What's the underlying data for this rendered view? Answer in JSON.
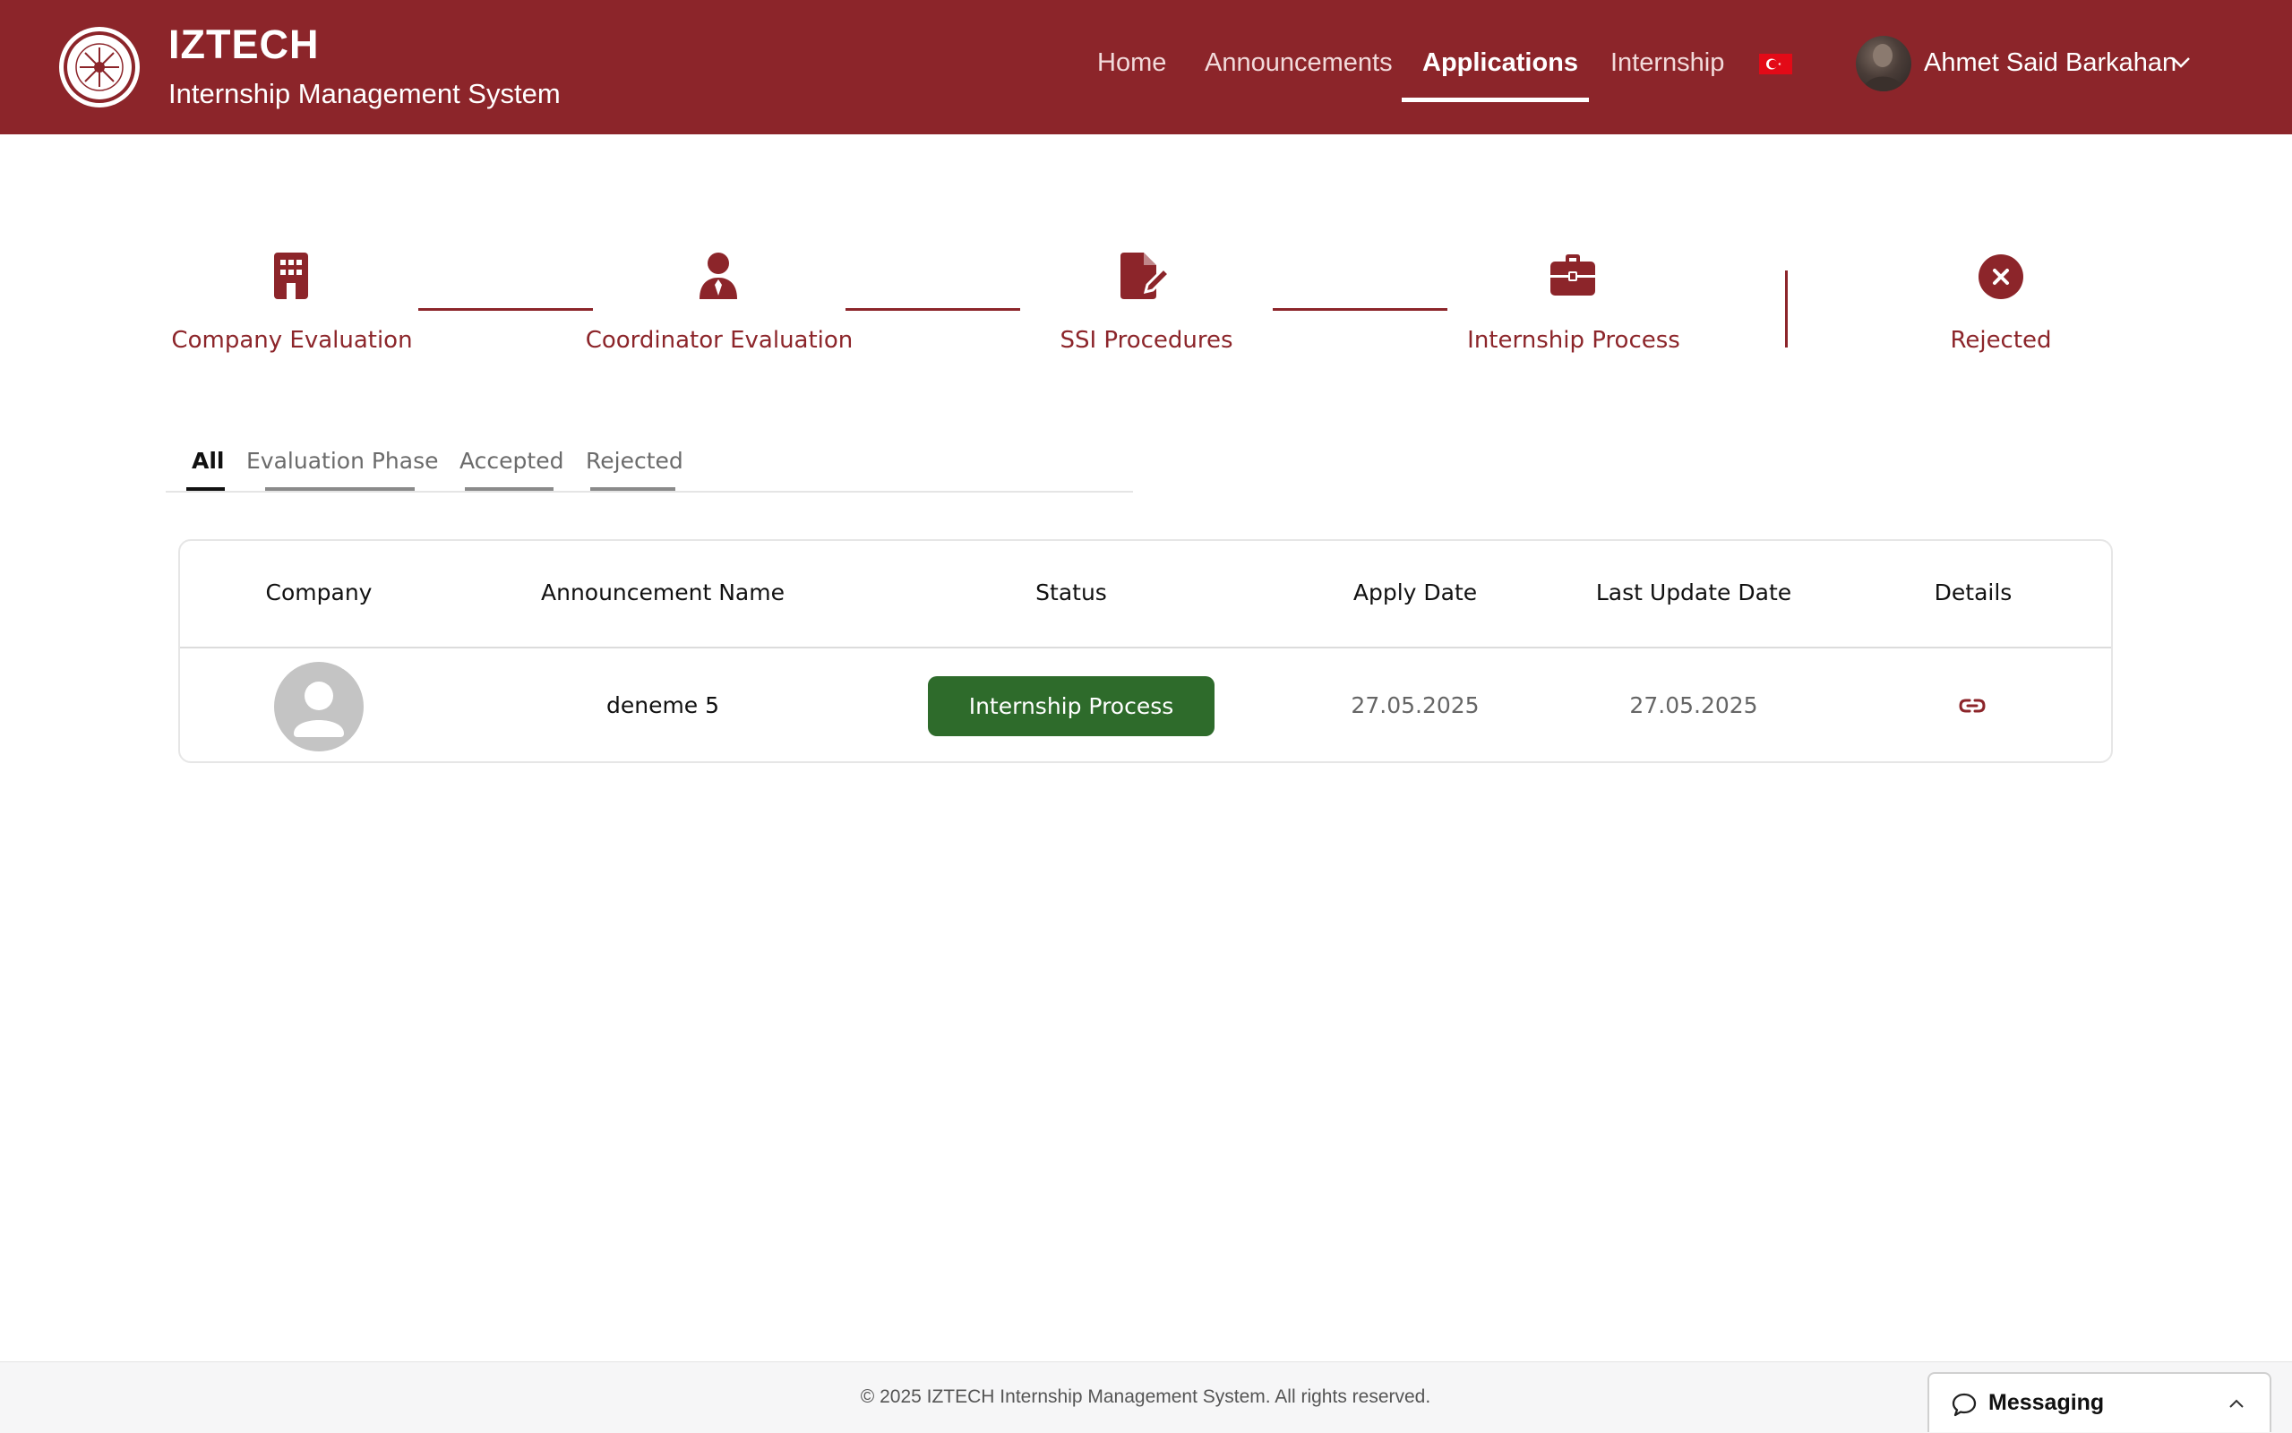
{
  "header": {
    "brand_title": "IZTECH",
    "brand_subtitle": "Internship Management System",
    "nav": [
      {
        "label": "Home",
        "active": false
      },
      {
        "label": "Announcements",
        "active": false
      },
      {
        "label": "Applications",
        "active": true
      },
      {
        "label": "Internship",
        "active": false
      }
    ],
    "language_flag": "turkey-flag-icon",
    "user": {
      "name": "Ahmet Said Barkahan"
    }
  },
  "stepper": {
    "steps": [
      {
        "label": "Company Evaluation",
        "icon": "building-icon"
      },
      {
        "label": "Coordinator Evaluation",
        "icon": "person-tie-icon"
      },
      {
        "label": "SSI Procedures",
        "icon": "file-edit-icon"
      },
      {
        "label": "Internship Process",
        "icon": "briefcase-icon"
      },
      {
        "label": "Rejected",
        "icon": "close-circle-icon"
      }
    ]
  },
  "tabs": [
    {
      "label": "All",
      "active": true
    },
    {
      "label": "Evaluation Phase",
      "active": false
    },
    {
      "label": "Accepted",
      "active": false
    },
    {
      "label": "Rejected",
      "active": false
    }
  ],
  "table": {
    "columns": [
      "Company",
      "Announcement Name",
      "Status",
      "Apply Date",
      "Last Update Date",
      "Details"
    ],
    "rows": [
      {
        "company_avatar": "default-avatar-icon",
        "announcement_name": "deneme 5",
        "status": "Internship Process",
        "apply_date": "27.05.2025",
        "last_update_date": "27.05.2025",
        "details_icon": "link-icon"
      }
    ]
  },
  "footer": {
    "copyright": "© 2025 IZTECH Internship Management System. All rights reserved."
  },
  "messaging": {
    "label": "Messaging"
  },
  "colors": {
    "brand": "#8c252a",
    "status_green": "#2e6b2b",
    "tab_active_underline": "#111111",
    "tab_inactive_underline": "#8a8a8a"
  }
}
